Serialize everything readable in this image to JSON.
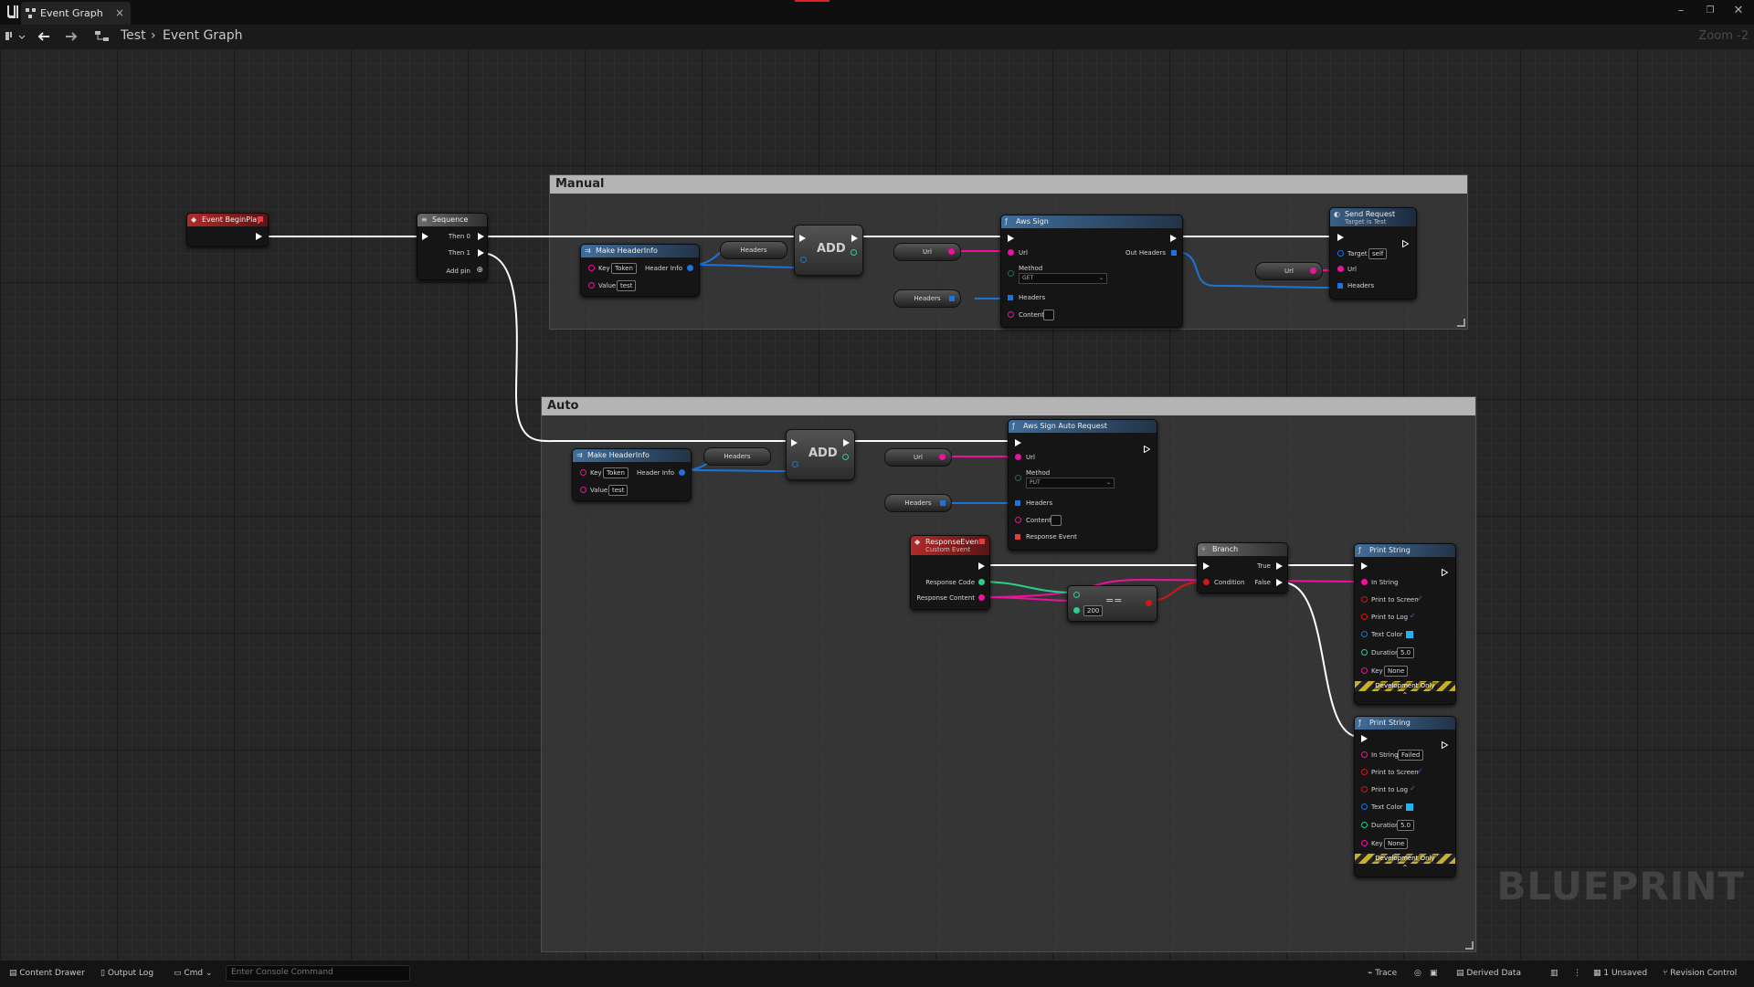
{
  "window": {
    "tab_label": "Event Graph",
    "tab_close": "×",
    "min": "–",
    "max": "❐",
    "close": "✕"
  },
  "toolbar": {
    "breadcrumb": [
      "Test",
      "Event Graph"
    ],
    "separator": "›",
    "zoom": "Zoom -2"
  },
  "comments": {
    "manual": "Manual",
    "auto": "Auto"
  },
  "nodes": {
    "begin_play": {
      "title": "Event BeginPlay"
    },
    "sequence": {
      "title": "Sequence",
      "then0": "Then 0",
      "then1": "Then 1",
      "add_pin": "Add pin"
    },
    "manual_make_header": {
      "title": "Make HeaderInfo",
      "key": "Key",
      "key_val": "Token",
      "value": "Value",
      "value_val": "test",
      "out": "Header Info"
    },
    "manual_headers_reroute": "Headers",
    "manual_add": "ADD",
    "manual_url": "Url",
    "manual_headers2": "Headers",
    "aws_sign": {
      "title": "Aws Sign",
      "url": "Url",
      "out_headers": "Out Headers",
      "method": "Method",
      "method_val": "GET",
      "headers": "Headers",
      "content": "Content"
    },
    "manual_url2": "Url",
    "send_request": {
      "title": "Send Request",
      "subtitle": "Target is Test",
      "target": "Target",
      "target_val": "self",
      "url": "Url",
      "headers": "Headers"
    },
    "auto_make_header": {
      "title": "Make HeaderInfo",
      "key": "Key",
      "key_val": "Token",
      "value": "Value",
      "value_val": "test",
      "out": "Header Info"
    },
    "auto_headers_reroute": "Headers",
    "auto_add": "ADD",
    "auto_url": "Url",
    "auto_headers2": "Headers",
    "aws_sign_auto": {
      "title": "Aws Sign Auto Request",
      "url": "Url",
      "method": "Method",
      "method_val": "PUT",
      "headers": "Headers",
      "content": "Content",
      "response_event": "Response Event"
    },
    "response_event": {
      "title": "ResponseEvent",
      "subtitle": "Custom Event",
      "code": "Response Code",
      "content": "Response Content"
    },
    "equals": {
      "op": "==",
      "val": "200"
    },
    "branch": {
      "title": "Branch",
      "true": "True",
      "false": "False",
      "condition": "Condition"
    },
    "print1": {
      "title": "Print String",
      "in_string": "In String",
      "to_screen": "Print to Screen",
      "to_log": "Print to Log",
      "text_color": "Text Color",
      "duration": "Duration",
      "duration_val": "5.0",
      "key": "Key",
      "key_val": "None",
      "dev": "Development Only"
    },
    "print2": {
      "title": "Print String",
      "in_string": "In String",
      "in_string_val": "Failed",
      "to_screen": "Print to Screen",
      "to_log": "Print to Log",
      "text_color": "Text Color",
      "duration": "Duration",
      "duration_val": "5.0",
      "key": "Key",
      "key_val": "None",
      "dev": "Development Only"
    }
  },
  "watermark": "BLUEPRINT",
  "status": {
    "content_drawer": "Content Drawer",
    "output_log": "Output Log",
    "cmd": "Cmd",
    "console_placeholder": "Enter Console Command",
    "trace": "Trace",
    "derived_data": "Derived Data",
    "unsaved": "1 Unsaved",
    "revision_control": "Revision Control"
  },
  "colors": {
    "exec": "#ffffff",
    "string": "#f0109e",
    "struct": "#1b74d6",
    "int": "#27d08b",
    "bool": "#d51616",
    "event_header": "#b32a2a",
    "function_header": "#3f6d9a"
  }
}
